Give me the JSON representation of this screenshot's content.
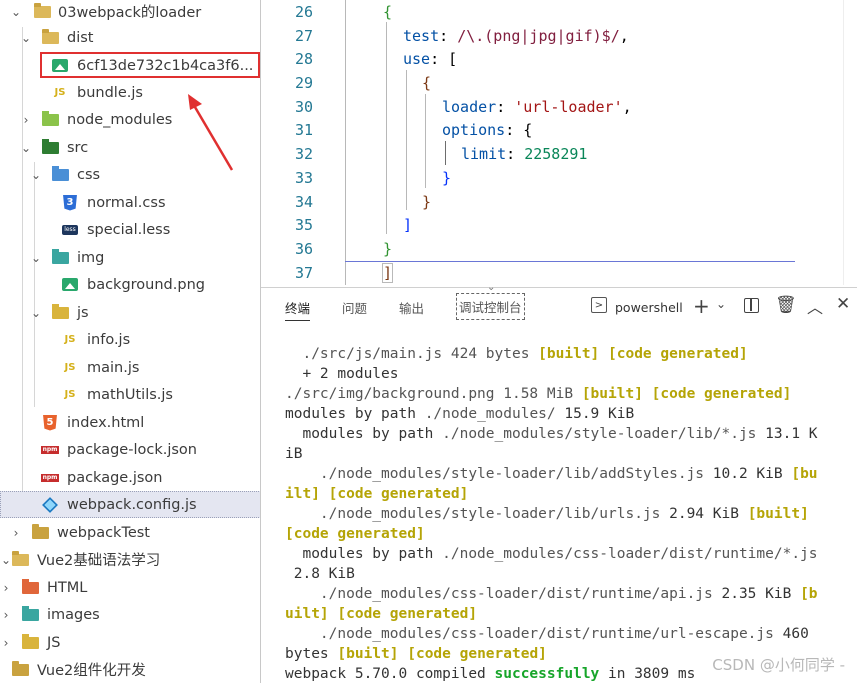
{
  "explorer": {
    "items": [
      {
        "label": "03webpack的loader"
      },
      {
        "label": "dist"
      },
      {
        "label": "6cf13de732c1b4ca3f6..."
      },
      {
        "label": "bundle.js"
      },
      {
        "label": "node_modules"
      },
      {
        "label": "src"
      },
      {
        "label": "css"
      },
      {
        "label": "normal.css"
      },
      {
        "label": "special.less"
      },
      {
        "label": "img"
      },
      {
        "label": "background.png"
      },
      {
        "label": "js"
      },
      {
        "label": "info.js"
      },
      {
        "label": "main.js"
      },
      {
        "label": "mathUtils.js"
      },
      {
        "label": "index.html"
      },
      {
        "label": "package-lock.json"
      },
      {
        "label": "package.json"
      },
      {
        "label": "webpack.config.js"
      },
      {
        "label": "webpackTest"
      },
      {
        "label": "Vue2基础语法学习"
      },
      {
        "label": "HTML"
      },
      {
        "label": "images"
      },
      {
        "label": "JS"
      },
      {
        "label": "Vue2组件化开发"
      }
    ]
  },
  "editor": {
    "line_numbers": [
      "26",
      "27",
      "28",
      "29",
      "30",
      "31",
      "32",
      "33",
      "34",
      "35",
      "36",
      "37"
    ],
    "code": {
      "l26": "{",
      "l27_key": "test",
      "l27_colon": ": ",
      "l27_regex": "/\\.(png|jpg|gif)$/",
      "l27_end": ",",
      "l28_key": "use",
      "l28_rest": ": [",
      "l29": "{",
      "l30_key": "loader",
      "l30_colon": ": ",
      "l30_str": "'url-loader'",
      "l30_end": ",",
      "l31_key": "options",
      "l31_rest": ": {",
      "l32_key": "limit",
      "l32_colon": ": ",
      "l32_num": "2258291",
      "l33": "}",
      "l34": "}",
      "l35": "]",
      "l36": "}",
      "l37": "]"
    }
  },
  "panel": {
    "tabs": [
      "终端",
      "问题",
      "输出",
      "调试控制台"
    ],
    "shell_label": "powershell",
    "icons": {
      "shell": "terminal-icon",
      "add": "plus-icon",
      "dropdown": "chevron-down-icon",
      "split": "split-icon",
      "trash": "trash-icon",
      "maximize": "chevron-up-icon",
      "close": "close-icon"
    }
  },
  "terminal": {
    "l1_path": "  ./src/js/main.js 424 bytes ",
    "l1_a": "[built]",
    "l1_b": "[code generated]",
    "l2": "  + 2 modules",
    "l3_path": "./src/img/background.png 1.58 MiB ",
    "l3_a": "[built]",
    "l3_b": "[code generated]",
    "l4_a": "modules by path ",
    "l4_b": "./node_modules/",
    "l4_c": " 15.9 KiB",
    "l5_a": "  modules by path ",
    "l5_b": "./node_modules/style-loader/lib/*.js",
    "l5_c": " 13.1 K",
    "l6": "iB",
    "l7_a": "    ./node_modules/style-loader/lib/addStyles.js",
    "l7_b": " 10.2 KiB ",
    "l7_c": "[bu",
    "l8_a": "ilt]",
    "l8_b": "[code generated]",
    "l9_a": "    ./node_modules/style-loader/lib/urls.js",
    "l9_b": " 2.94 KiB ",
    "l9_c": "[built]",
    "l10": "[code generated]",
    "l11_a": "  modules by path ",
    "l11_b": "./node_modules/css-loader/dist/runtime/*.js",
    "l12": " 2.8 KiB",
    "l13_a": "    ./node_modules/css-loader/dist/runtime/api.js",
    "l13_b": " 2.35 KiB ",
    "l13_c": "[b",
    "l14_a": "uilt]",
    "l14_b": "[code generated]",
    "l15_a": "    ./node_modules/css-loader/dist/runtime/url-escape.js",
    "l15_b": " 460",
    "l16_a": "bytes ",
    "l16_b": "[built]",
    "l16_c": "[code generated]",
    "l17_a": "webpack 5.70.0 compiled ",
    "l17_b": "successfully",
    "l17_c": " in 3809 ms"
  },
  "watermark": "CSDN @小何同学 -"
}
